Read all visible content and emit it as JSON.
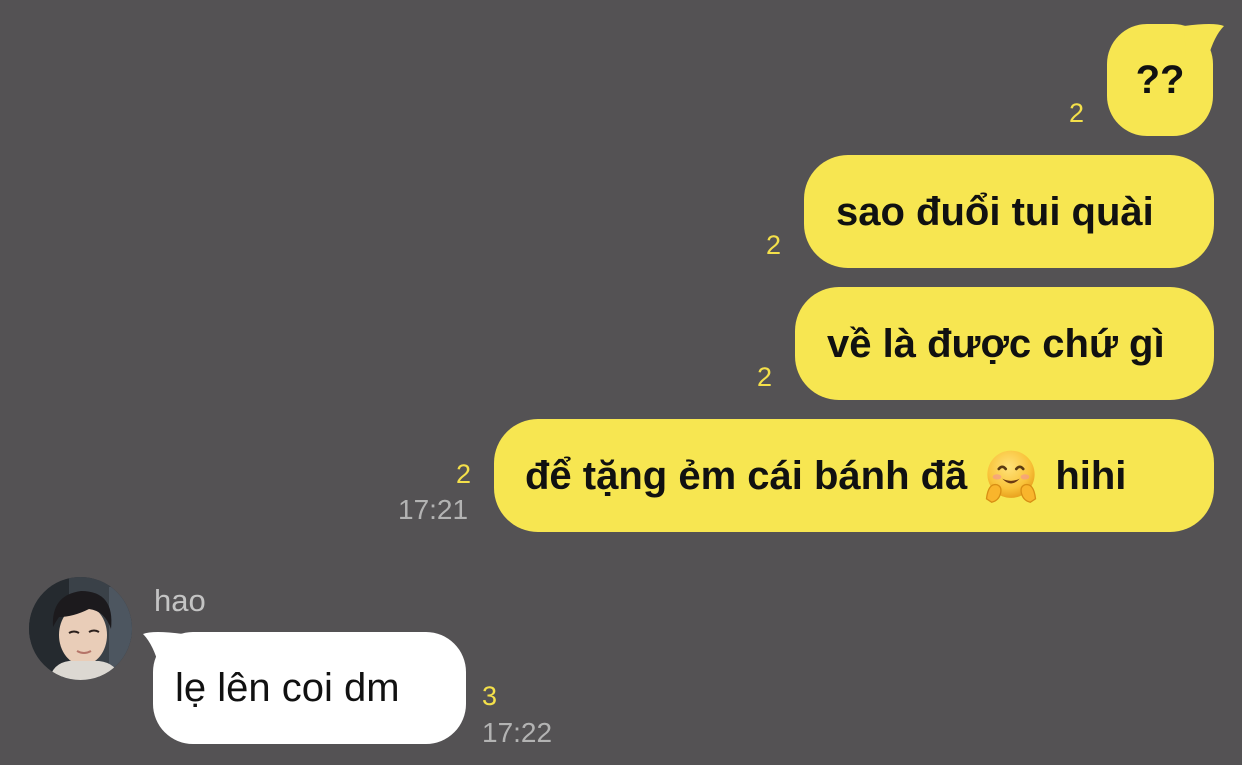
{
  "messages": [
    {
      "text": "??",
      "unread": "2",
      "time": ""
    },
    {
      "text": "sao đuổi tui quài",
      "unread": "2",
      "time": ""
    },
    {
      "text": "về là được chứ gì",
      "unread": "2",
      "time": ""
    },
    {
      "text_before": "để tặng ẻm cái bánh đã",
      "emoji": "hugging-face-icon",
      "text_after": "hihi",
      "unread": "2",
      "time": "17:21"
    }
  ],
  "incoming": {
    "sender": "hao",
    "text": "lẹ lên coi dm",
    "unread": "3",
    "time": "17:22",
    "avatar": "avatar-photo"
  },
  "colors": {
    "background": "#545254",
    "outgoing_bubble": "#f7e651",
    "incoming_bubble": "#ffffff",
    "unread_count": "#f4e04a",
    "timestamp": "#b3b3b3"
  }
}
